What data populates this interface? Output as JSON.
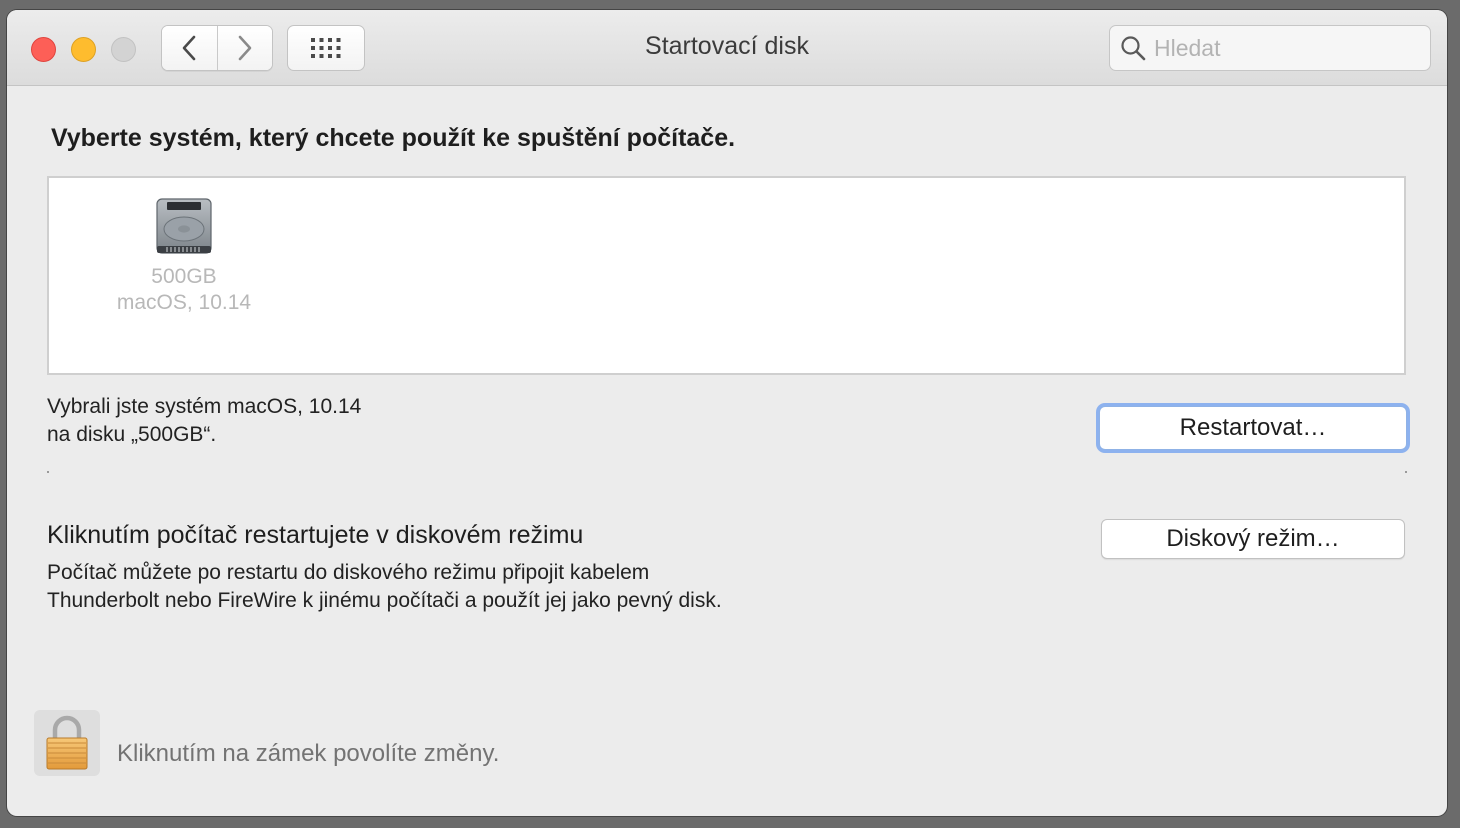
{
  "window": {
    "title": "Startovací disk",
    "search_placeholder": "Hledat"
  },
  "icons": {
    "back": "chevron-left-icon",
    "forward": "chevron-right-icon",
    "grid": "grid-icon",
    "search": "search-icon",
    "disk": "hard-disk-icon",
    "lock": "lock-icon"
  },
  "main": {
    "heading": "Vyberte systém, který chcete použít ke spuštění počítače.",
    "disks": [
      {
        "name": "500GB",
        "os": "macOS, 10.14"
      }
    ],
    "selection_line1": "Vybrali jste systém macOS, 10.14",
    "selection_line2": "na disku „500GB“.",
    "restart_button": "Restartovat…",
    "disk_mode_title": "Kliknutím počítač restartujete v diskovém režimu",
    "disk_mode_desc_line1": "Počítač můžete po restartu do diskového režimu připojit kabelem",
    "disk_mode_desc_line2": "Thunderbolt nebo FireWire k jinému počítači a použít jej jako pevný disk.",
    "disk_mode_button": "Diskový režim…"
  },
  "footer": {
    "lock_text": "Kliknutím na zámek povolíte změny."
  },
  "colors": {
    "close": "#fd5f57",
    "minimize": "#febc2e",
    "focus_ring": "#8db2ef"
  }
}
